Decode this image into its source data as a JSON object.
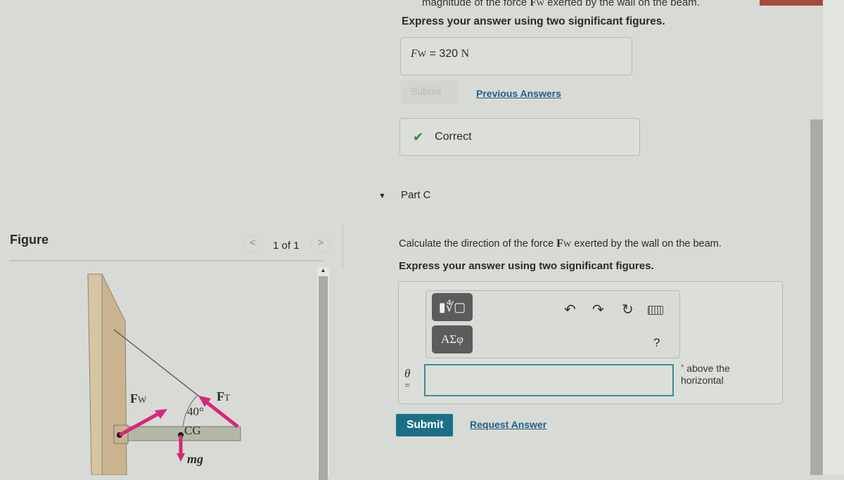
{
  "partB": {
    "question_tail": "magnitude of the force",
    "question_symbol": "F",
    "question_sub": "W",
    "question_end": "exerted by the wall on the beam.",
    "instruction": "Express your answer using two significant figures.",
    "answer_var": "F",
    "answer_sub": "W",
    "answer_eq": "=",
    "answer_value": "320",
    "answer_unit": "N",
    "submit_label": "Submit",
    "previous_answers_label": "Previous Answers",
    "feedback": "Correct"
  },
  "partC": {
    "title": "Part C",
    "question_start": "Calculate the direction of the force",
    "question_symbol": "F",
    "question_sub": "W",
    "question_end": "exerted by the wall on the beam.",
    "instruction": "Express your answer using two significant figures.",
    "toolbar": {
      "templates_icon": "sqrt-template-icon",
      "greek_label": "ΑΣφ",
      "undo_icon": "undo-icon",
      "redo_icon": "redo-icon",
      "reset_icon": "reset-icon",
      "keyboard_icon": "keyboard-icon",
      "help_label": "?"
    },
    "input_label": "θ",
    "input_eq": "=",
    "input_value": "",
    "unit_degree": "°",
    "unit_text_1": "above the",
    "unit_text_2": "horizontal",
    "submit_label": "Submit",
    "request_answer_label": "Request Answer"
  },
  "figure": {
    "title": "Figure",
    "pager": "1 of 1",
    "labels": {
      "fw": "F",
      "fw_sub": "W",
      "ft": "F",
      "ft_sub": "T",
      "angle": "40°",
      "cg": "CG",
      "mg": "mg"
    }
  },
  "colors": {
    "accent": "#1d6f86",
    "force_arrow": "#d4287a",
    "correct": "#2f8a3a",
    "wall": "#c9b48f"
  }
}
